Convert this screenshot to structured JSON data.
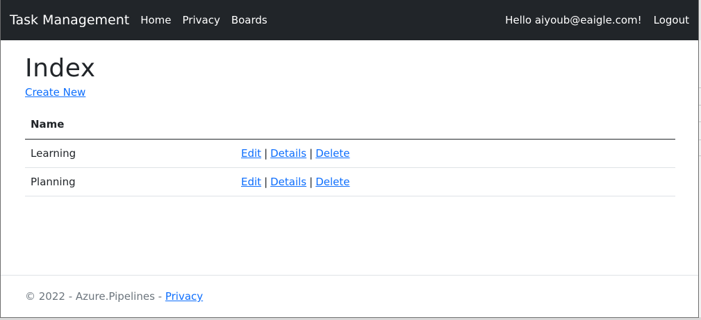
{
  "navbar": {
    "brand": "Task Management",
    "links": [
      "Home",
      "Privacy",
      "Boards"
    ],
    "greeting": "Hello aiyoub@eaigle.com!",
    "logout": "Logout"
  },
  "main": {
    "title": "Index",
    "create_link": "Create New",
    "table": {
      "header": "Name",
      "rows": [
        {
          "name": "Learning",
          "actions": [
            "Edit",
            "Details",
            "Delete"
          ]
        },
        {
          "name": "Planning",
          "actions": [
            "Edit",
            "Details",
            "Delete"
          ]
        }
      ],
      "separator": "|"
    }
  },
  "footer": {
    "text": "© 2022 - Azure.Pipelines -",
    "link": "Privacy"
  },
  "colors": {
    "navbar_bg": "#212529",
    "link": "#0d6efd",
    "footer_text": "#6c757d"
  }
}
